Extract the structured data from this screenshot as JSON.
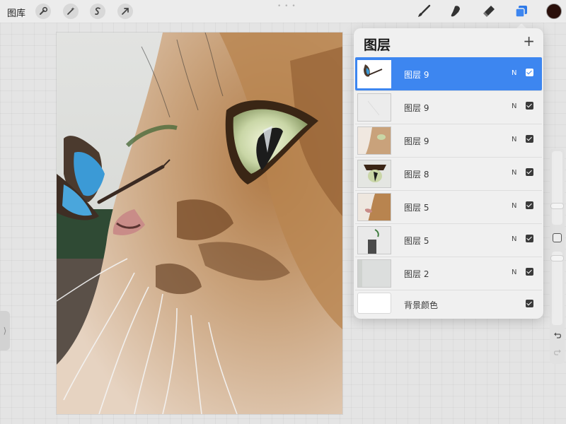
{
  "app": {
    "gallery_label": "图库",
    "toolbar_icons": [
      "wrench-icon",
      "magic-wand-icon",
      "selection-icon",
      "transform-arrow-icon"
    ],
    "right_tools": [
      "brush-icon",
      "smudge-icon",
      "eraser-icon",
      "layers-icon"
    ],
    "current_color": "#2a0f0a",
    "accent": "#3d86f0"
  },
  "layers_panel": {
    "title": "图层",
    "add_symbol": "+",
    "layers": [
      {
        "name": "图层 9",
        "blend": "N",
        "visible": true,
        "active": true
      },
      {
        "name": "图层 9",
        "blend": "N",
        "visible": true,
        "active": false
      },
      {
        "name": "图层 9",
        "blend": "N",
        "visible": true,
        "active": false
      },
      {
        "name": "图层 8",
        "blend": "N",
        "visible": true,
        "active": false
      },
      {
        "name": "图层 5",
        "blend": "N",
        "visible": true,
        "active": false
      },
      {
        "name": "图层 5",
        "blend": "N",
        "visible": true,
        "active": false
      },
      {
        "name": "图层 2",
        "blend": "N",
        "visible": true,
        "active": false
      }
    ],
    "background": {
      "name": "背景颜色",
      "visible": true
    }
  },
  "sidebar": {
    "left_tab_glyph": "⟩"
  }
}
